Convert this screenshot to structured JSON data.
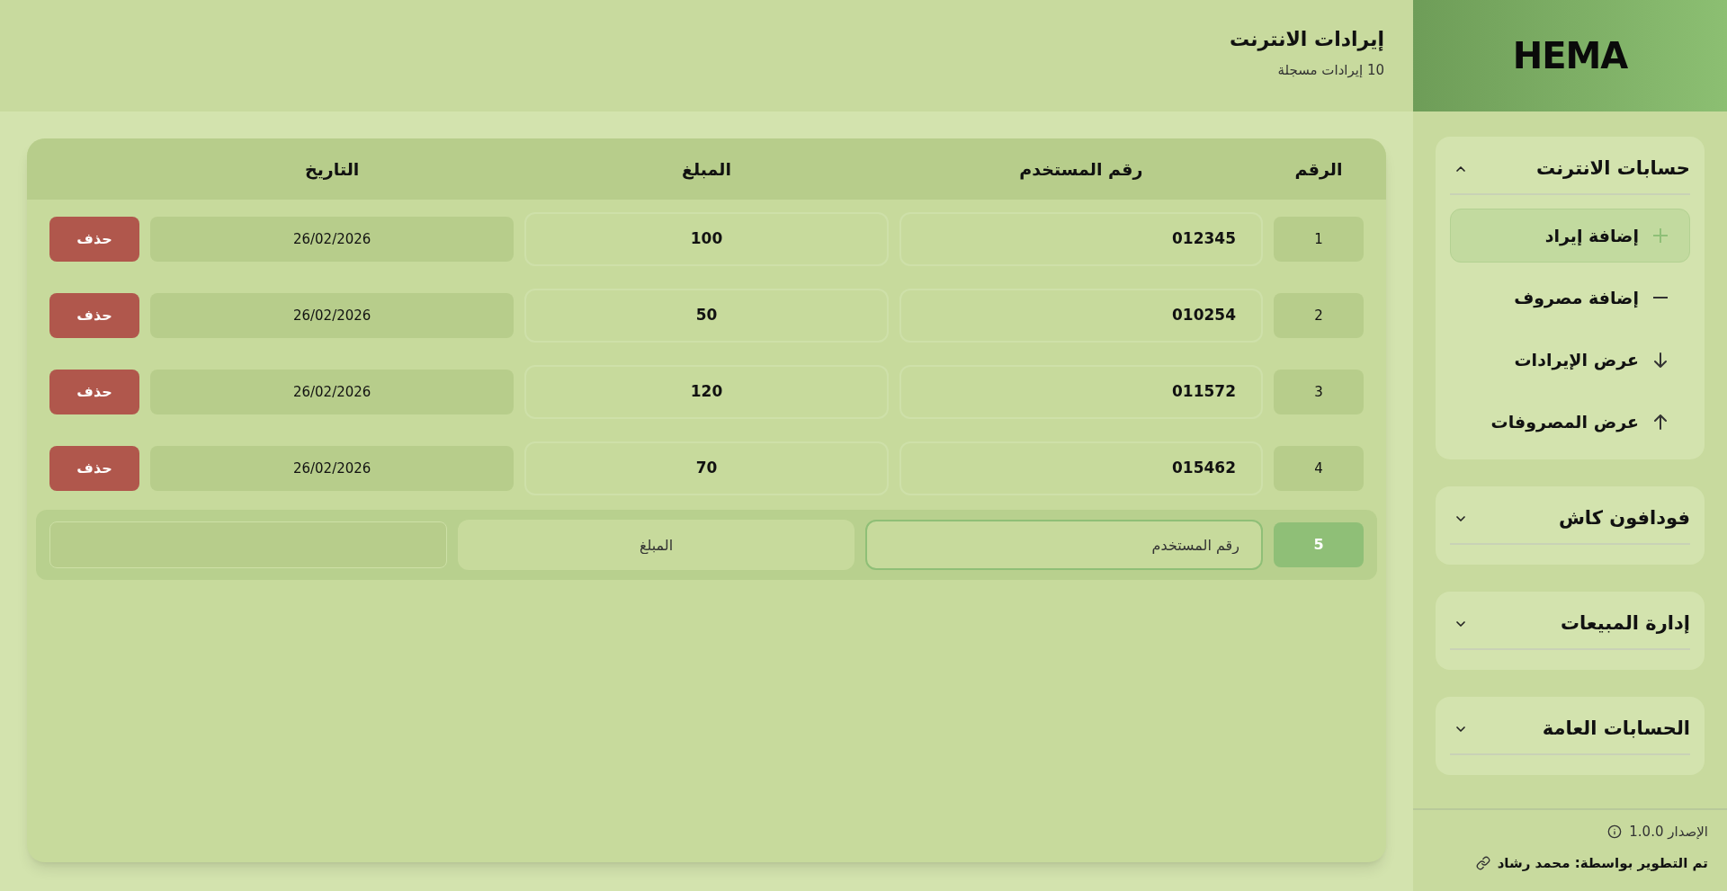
{
  "sidebar": {
    "logo": "HEMA",
    "sections": [
      {
        "title": "حسابات الانترنت",
        "expanded": true,
        "items": [
          {
            "label": "إضافة إيراد",
            "selected": true
          },
          {
            "label": "إضافة مصروف",
            "selected": false
          },
          {
            "label": "عرض الإيرادات",
            "selected": false
          },
          {
            "label": "عرض المصروفات",
            "selected": false
          }
        ]
      },
      {
        "title": "فودافون كاش",
        "expanded": false
      },
      {
        "title": "إدارة المبيعات",
        "expanded": false
      },
      {
        "title": "الحسابات العامة",
        "expanded": false
      }
    ],
    "footer": {
      "version": "الإصدار 1.0.0",
      "credit": "تم التطوير بواسطة: محمد رشاد"
    }
  },
  "header": {
    "title": "إيرادات الانترنت",
    "subtitle": "10 إيرادات مسجلة"
  },
  "table": {
    "columns": [
      "الرقم",
      "رقم المستخدم",
      "المبلغ",
      "التاريخ"
    ],
    "rows": [
      {
        "number": "1",
        "user_id": "012345",
        "amount": "100",
        "date": "26/02/2026",
        "action": "حذف"
      },
      {
        "number": "2",
        "user_id": "010254",
        "amount": "50",
        "date": "26/02/2026",
        "action": "حذف"
      },
      {
        "number": "3",
        "user_id": "011572",
        "amount": "120",
        "date": "26/02/2026",
        "action": "حذف"
      },
      {
        "number": "4",
        "user_id": "015462",
        "amount": "70",
        "date": "26/02/2026",
        "action": "حذف"
      }
    ],
    "new_row": {
      "number": "5",
      "user_id": {
        "placeholder": "رقم المستخدم",
        "focused": true
      },
      "amount": {
        "placeholder": "المبلغ",
        "focused": false
      }
    }
  }
}
